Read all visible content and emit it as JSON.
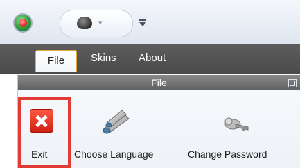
{
  "quick_access": {
    "app_orb_icon": "app-orb-icon",
    "custom_button_icon": "quick-access-icon",
    "customize_icon": "customize-toolbar-icon"
  },
  "tabs": [
    {
      "label": "File",
      "active": true
    },
    {
      "label": "Skins",
      "active": false
    },
    {
      "label": "About",
      "active": false
    }
  ],
  "ribbon": {
    "group_title": "File",
    "buttons": [
      {
        "label": "Exit",
        "icon": "exit-icon"
      },
      {
        "label": "Choose Language",
        "icon": "language-icon"
      },
      {
        "label": "Change Password",
        "icon": "key-icon"
      }
    ]
  },
  "colors": {
    "highlight": "#e23a35",
    "tab_accent": "#e7a93d",
    "tabbar": "#4a4a4a"
  }
}
